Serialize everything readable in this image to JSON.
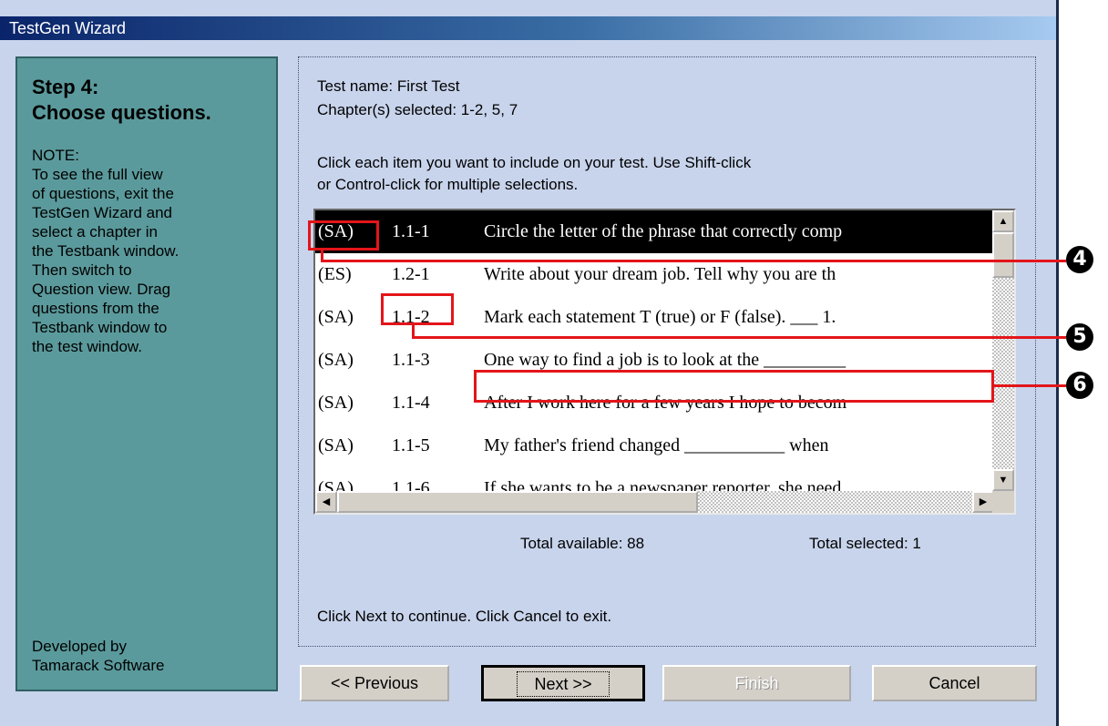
{
  "window": {
    "title": "TestGen Wizard"
  },
  "left_panel": {
    "step_line1": "Step 4:",
    "step_line2": "Choose questions.",
    "note_label": "NOTE:",
    "note_lines": [
      "To see the full view",
      "of questions, exit the",
      "TestGen Wizard and",
      "select a chapter in",
      "the Testbank window.",
      "Then switch to",
      "Question view. Drag",
      "questions from the",
      "Testbank window to",
      "the test window."
    ],
    "developer_line1": "Developed by",
    "developer_line2": "Tamarack Software"
  },
  "main": {
    "test_name": "Test name: First Test",
    "chapters": "Chapter(s) selected: 1-2, 5, 7",
    "instruction_line1": "Click each item you want to include on your test. Use Shift-click",
    "instruction_line2": "or Control-click for multiple selections.",
    "questions": [
      {
        "type": "(SA)",
        "id": "1.1-1",
        "text": "Circle the letter of the phrase that correctly comp",
        "selected": true
      },
      {
        "type": "(ES)",
        "id": "1.2-1",
        "text": "Write about your dream job.  Tell why you are th",
        "selected": false
      },
      {
        "type": "(SA)",
        "id": "1.1-2",
        "text": "Mark each statement T (true) or F (false).  ___ 1.",
        "selected": false
      },
      {
        "type": "(SA)",
        "id": "1.1-3",
        "text": "One way to find a job is to look at the _________",
        "selected": false
      },
      {
        "type": "(SA)",
        "id": "1.1-4",
        "text": "After I work here for a few years I hope to becom",
        "selected": false
      },
      {
        "type": "(SA)",
        "id": "1.1-5",
        "text": "My father's friend changed ___________ when",
        "selected": false
      },
      {
        "type": "(SA)",
        "id": "1.1-6",
        "text": "If she wants to be a newspaper reporter, she need",
        "selected": false
      }
    ],
    "total_available": "Total available: 88",
    "total_selected": "Total selected: 1",
    "continue_text": "Click Next to continue. Click Cancel to exit."
  },
  "buttons": {
    "previous": "<< Previous",
    "next": "Next >>",
    "finish": "Finish",
    "cancel": "Cancel"
  },
  "callouts": [
    "4",
    "5",
    "6"
  ],
  "colors": {
    "callout_red": "#e3151a",
    "left_panel": "#5b9a9c",
    "background": "#c8d4ec"
  }
}
